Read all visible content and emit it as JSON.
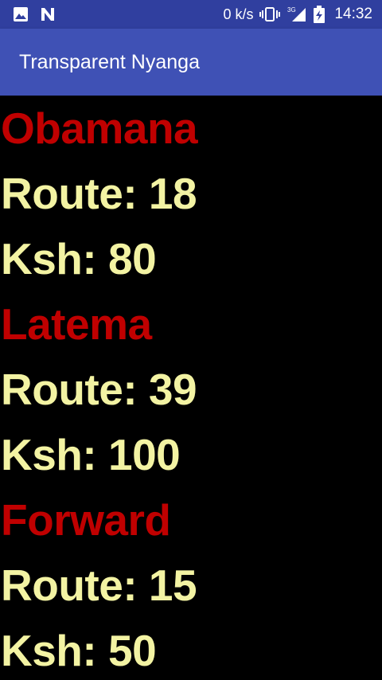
{
  "status_bar": {
    "left_icons": [
      "image-icon",
      "n-logo-icon"
    ],
    "network_speed": "0 k/s",
    "network_type": "3G",
    "time": "14:32",
    "colors": {
      "background": "#303F9F",
      "foreground": "#FFFFFF"
    }
  },
  "app_bar": {
    "title": "Transparent Nyanga",
    "color": "#3F51B5"
  },
  "entries": [
    {
      "name": "Obamana",
      "route": "Route: 18",
      "fare": "Ksh: 80"
    },
    {
      "name": "Latema",
      "route": "Route: 39",
      "fare": "Ksh: 100"
    },
    {
      "name": "Forward",
      "route": "Route: 15",
      "fare": "Ksh: 50"
    }
  ],
  "colors": {
    "background": "#000000",
    "name_text": "#C00000",
    "detail_text": "#F3F3A3"
  }
}
